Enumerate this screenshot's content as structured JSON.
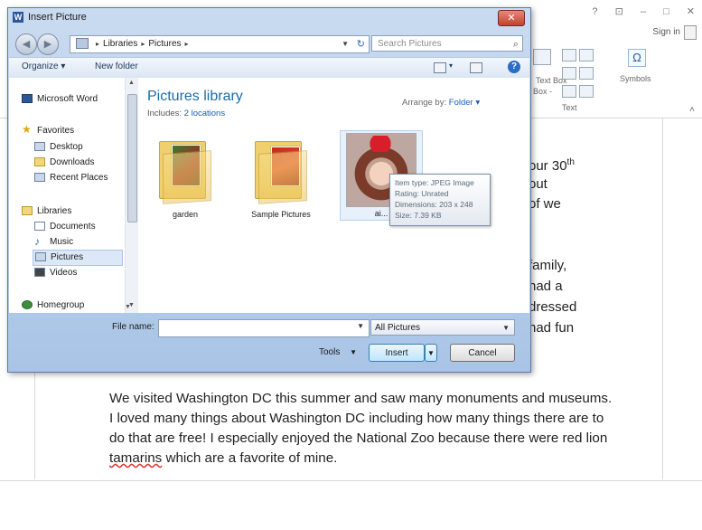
{
  "word": {
    "window_controls": [
      "?",
      "⊡",
      "–",
      "□",
      "✕"
    ],
    "signin": "Sign in",
    "ribbon": {
      "textbox_label": "Text Box",
      "textbox_label2": "Box -",
      "text_group": "Text",
      "symbols_label": "Symbols",
      "omega": "Ω"
    },
    "side_lines": [
      "our 30",
      "out",
      "of we",
      "family,",
      "had a",
      "dressed",
      "had fun"
    ],
    "sup": "th",
    "paragraph_before": "We visited Washington DC this summer and saw many monuments and museums.  I loved many things about Washington DC including how many things there are to do that are free!  I especially enjoyed the National Zoo because there were red lion ",
    "misspelled": "tamarins",
    "paragraph_after": " which are a favorite of mine."
  },
  "dialog": {
    "title": "Insert Picture",
    "close": "✕",
    "address": {
      "parts": [
        "Libraries",
        "Pictures"
      ],
      "sep": "▸"
    },
    "search_placeholder": "Search Pictures",
    "toolbar": {
      "organize": "Organize ▾",
      "new_folder": "New folder"
    },
    "nav": [
      {
        "label": "Microsoft Word",
        "icon": "word-icon"
      },
      {
        "label": "Favorites",
        "icon": "star-icon"
      },
      {
        "label": "Desktop",
        "icon": "desktop-icon"
      },
      {
        "label": "Downloads",
        "icon": "downloads-icon"
      },
      {
        "label": "Recent Places",
        "icon": "recent-places-icon"
      },
      {
        "label": "Libraries",
        "icon": "libraries-icon"
      },
      {
        "label": "Documents",
        "icon": "documents-icon"
      },
      {
        "label": "Music",
        "icon": "music-icon"
      },
      {
        "label": "Pictures",
        "icon": "pictures-icon"
      },
      {
        "label": "Videos",
        "icon": "videos-icon"
      },
      {
        "label": "Homegroup",
        "icon": "homegroup-icon"
      }
    ],
    "library_title": "Pictures library",
    "includes_label": "Includes:",
    "includes_link": "2 locations",
    "arrange_label": "Arrange by:",
    "arrange_value": "Folder ▾",
    "files": [
      {
        "name": "garden"
      },
      {
        "name": "Sample Pictures"
      },
      {
        "name": "ai..."
      }
    ],
    "tooltip": {
      "type": "Item type: JPEG Image",
      "rating": "Rating: Unrated",
      "dimensions": "Dimensions: 203 x 248",
      "size": "Size: 7.39 KB"
    },
    "file_name_label": "File name:",
    "file_name_value": "",
    "filter": "All Pictures",
    "tools": "Tools",
    "insert": "Insert",
    "cancel": "Cancel"
  }
}
